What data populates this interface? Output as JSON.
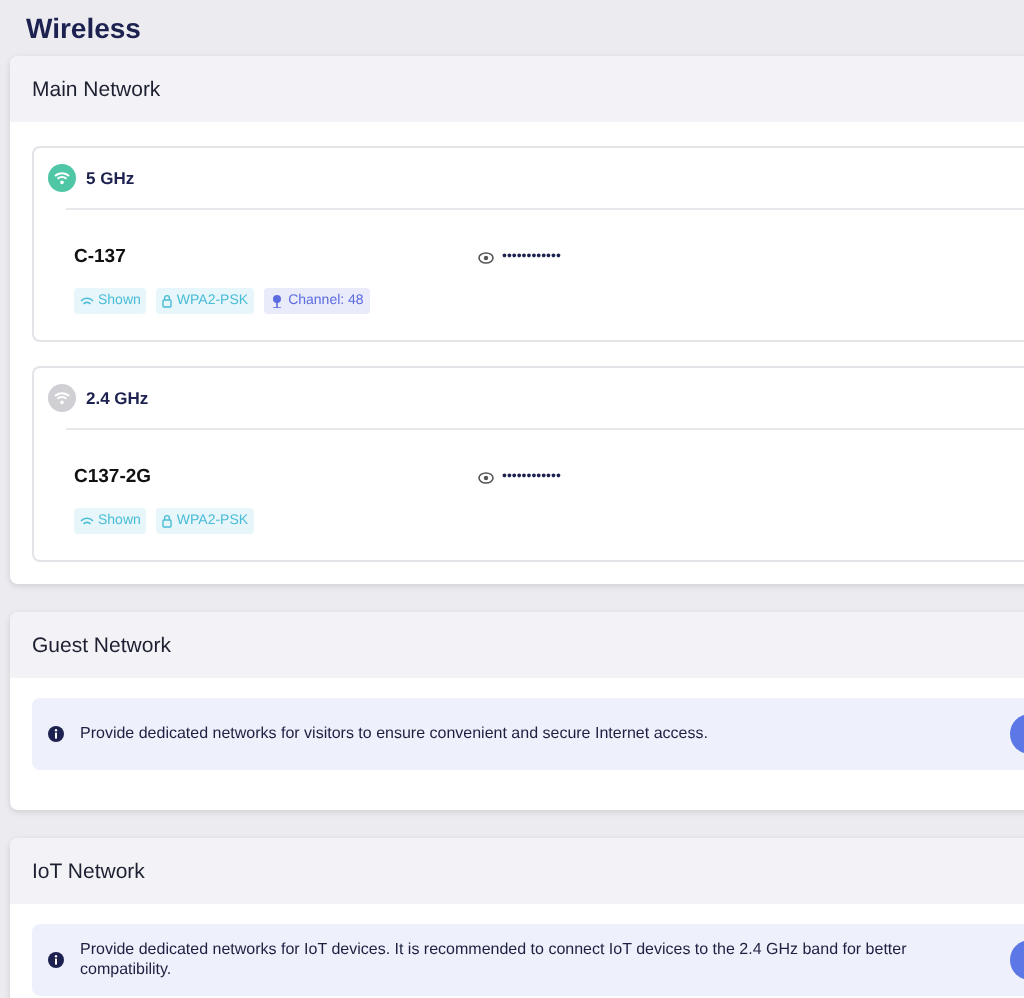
{
  "page_title": "Wireless",
  "main_network": {
    "title": "Main Network",
    "bands": [
      {
        "label": "5 GHz",
        "active": true,
        "ssid": "C-137",
        "password": "••••••••••••",
        "tags": [
          {
            "kind": "visibility",
            "text": "Shown"
          },
          {
            "kind": "security",
            "text": "WPA2-PSK"
          },
          {
            "kind": "channel",
            "text": "Channel: 48"
          }
        ]
      },
      {
        "label": "2.4 GHz",
        "active": false,
        "ssid": "C137-2G",
        "password": "••••••••••••",
        "tags": [
          {
            "kind": "visibility",
            "text": "Shown"
          },
          {
            "kind": "security",
            "text": "WPA2-PSK"
          }
        ]
      }
    ]
  },
  "sections": [
    {
      "title": "Guest Network",
      "info": "Provide dedicated networks for visitors to ensure convenient and secure Internet access.",
      "on": true
    },
    {
      "title": "IoT Network",
      "info": "Provide dedicated networks for IoT devices. It is recommended to connect IoT devices to the 2.4 GHz band for better compatibility.",
      "on": true
    }
  ]
}
